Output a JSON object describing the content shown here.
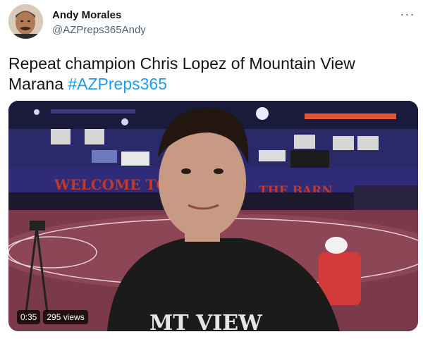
{
  "tweet": {
    "author_name": "Andy Morales",
    "author_handle": "@AZPreps365Andy",
    "text": "Repeat champion Chris Lopez of Mountain View Marana ",
    "hashtag": "#AZPreps365",
    "more_icon": "more-horizontal-icon",
    "video": {
      "duration": "0:35",
      "views": "295 views",
      "scene": {
        "banner_left": "WELCOME TO",
        "banner_right": "THE BARN",
        "shirt_text": "MT VIEW"
      }
    }
  },
  "colors": {
    "hashtag": "#1d9bf0",
    "handle": "#536471",
    "banner_text": "#c0392b"
  }
}
